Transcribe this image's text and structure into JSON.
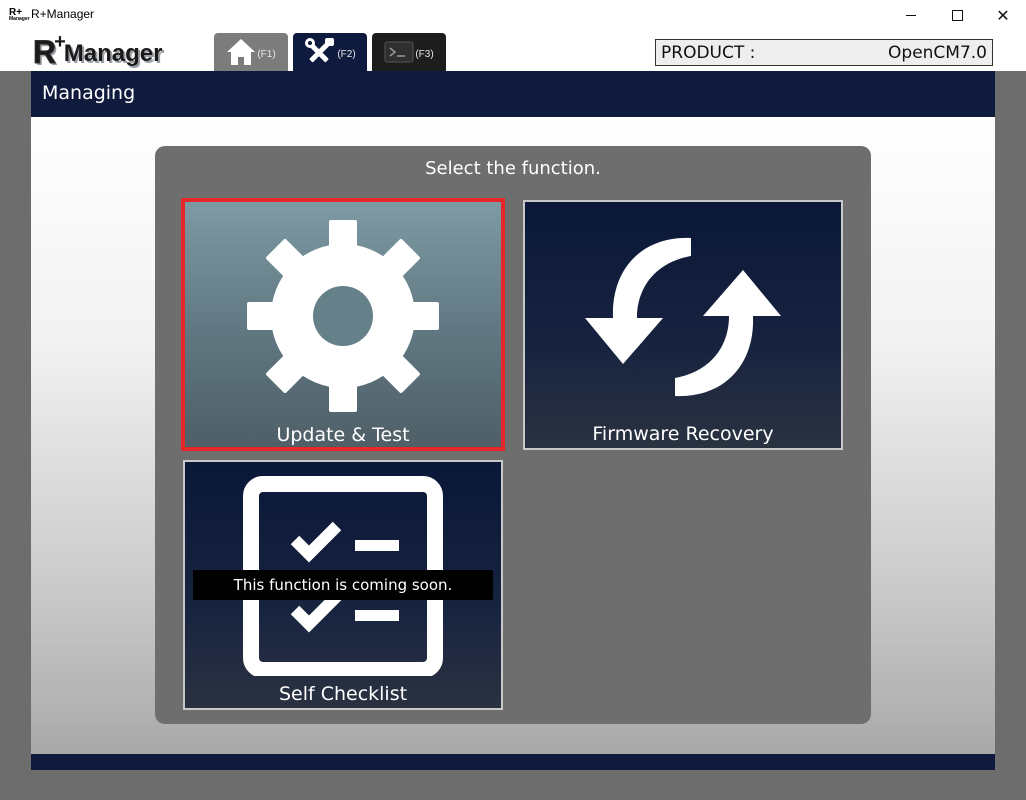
{
  "window": {
    "title": "R+Manager",
    "icon_text": "R+",
    "icon_subtext": "Manager"
  },
  "header": {
    "logo_r": "R",
    "logo_plus": "+",
    "logo_word": "Manager",
    "tabs": [
      {
        "icon": "home-icon",
        "key": "(F1)"
      },
      {
        "icon": "tools-icon",
        "key": "(F2)"
      },
      {
        "icon": "terminal-icon",
        "key": "(F3)"
      }
    ],
    "product_label": "PRODUCT :",
    "product_value": "OpenCM7.0"
  },
  "section": {
    "title": "Managing"
  },
  "panel": {
    "title": "Select the function.",
    "cards": [
      {
        "label": "Update & Test",
        "icon": "gear-icon",
        "selected": true
      },
      {
        "label": "Firmware Recovery",
        "icon": "refresh-arrows-icon",
        "selected": false
      },
      {
        "label": "Self Checklist",
        "icon": "checklist-icon",
        "selected": false
      }
    ],
    "tooltip": "This function is coming soon."
  },
  "colors": {
    "navy": "#0f1a3d",
    "selected_border": "#e5262b",
    "frame_gray": "#6d6d6d"
  }
}
